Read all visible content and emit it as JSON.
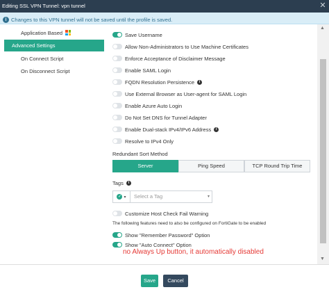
{
  "window": {
    "title": "Editing SSL VPN Tunnel: vpn tunnel"
  },
  "info": {
    "message": "Changes to this VPN tunnel will not be saved until the profile is saved."
  },
  "sidebar": {
    "items": [
      {
        "label": "Application Based",
        "active": false,
        "icon": "microsoft-logo"
      },
      {
        "label": "Advanced Settings",
        "active": true
      },
      {
        "label": "On Connect Script",
        "active": false
      },
      {
        "label": "On Disconnect Script",
        "active": false
      }
    ]
  },
  "settings": {
    "items": [
      {
        "label": "Save Username",
        "on": true
      },
      {
        "label": "Allow Non-Administrators to Use Machine Certificates",
        "on": false
      },
      {
        "label": "Enforce Acceptance of Disclaimer Message",
        "on": false
      },
      {
        "label": "Enable SAML Login",
        "on": false
      },
      {
        "label": "FQDN Resolution Persistence",
        "on": false,
        "help": true
      },
      {
        "label": "Use External Browser as User-agent for SAML Login",
        "on": false
      },
      {
        "label": "Enable Azure Auto Login",
        "on": false
      },
      {
        "label": "Do Not Set DNS for Tunnel Adapter",
        "on": false
      },
      {
        "label": "Enable Dual-stack IPv4/IPv6 Address",
        "on": false,
        "help": true
      },
      {
        "label": "Resolve to IPv4 Only",
        "on": false
      }
    ]
  },
  "redundant_sort": {
    "label": "Redundant Sort Method",
    "options": [
      "Server",
      "Ping Speed",
      "TCP Round Trip Time"
    ],
    "selected": "Server"
  },
  "tags": {
    "label": "Tags",
    "placeholder": "Select a Tag"
  },
  "host_check": {
    "label": "Customize Host Check Fail Warning",
    "on": false
  },
  "note": "The following features need to also be configured on FortiGate to be enabled",
  "fortigate_features": [
    {
      "label": "Show \"Remember Password\" Option",
      "on": true
    },
    {
      "label": "Show \"Auto Connect\" Option",
      "on": true
    }
  ],
  "annotation": "no Always Up button, it automatically disabled",
  "footer": {
    "save_label": "Save",
    "cancel_label": "Cancel"
  },
  "colors": {
    "accent": "#26a68a",
    "titlebar": "#2c3e50",
    "info_bg": "#d9edf7",
    "annotation": "#e53935"
  }
}
